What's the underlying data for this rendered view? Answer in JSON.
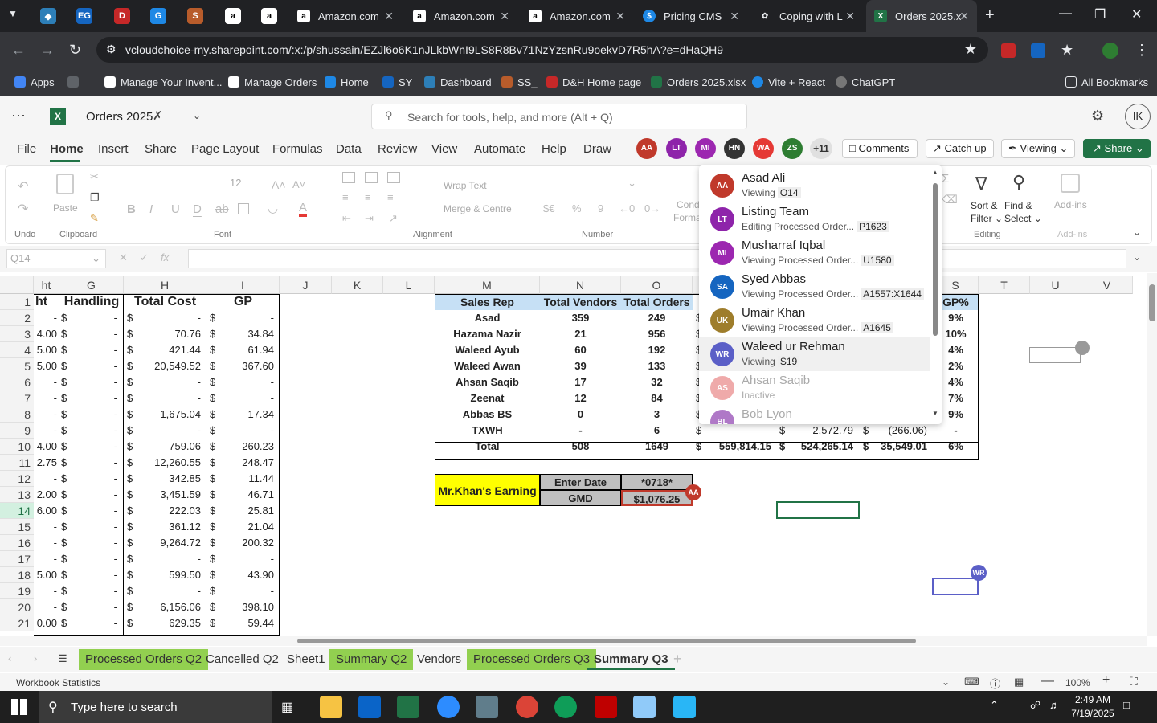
{
  "browser": {
    "tabs": [
      {
        "label": "Amazon.com"
      },
      {
        "label": "Amazon.com"
      },
      {
        "label": "Amazon.com"
      },
      {
        "label": "Pricing CMS"
      },
      {
        "label": "Coping with L"
      },
      {
        "label": "Orders 2025.x"
      }
    ],
    "address": "vcloudchoice-my.sharepoint.com/:x:/p/shussain/EZJl6o6K1nJLkbWnI9LS8R8Bv71NzYzsnRu9oekvD7R5hA?e=dHaQH9",
    "bookmarks": [
      "Apps",
      "Manage Your Invent...",
      "Manage Orders",
      "Home",
      "SY",
      "Dashboard",
      "SS_",
      "D&H Home page",
      "Orders 2025.xlsx",
      "Vite + React",
      "ChatGPT"
    ],
    "all_bookmarks": "All Bookmarks"
  },
  "excel": {
    "doc_title": "Orders 2025",
    "search_placeholder": "Search for tools, help, and more (Alt + Q)",
    "user_initials": "IK",
    "menu": [
      "File",
      "Home",
      "Insert",
      "Share",
      "Page Layout",
      "Formulas",
      "Data",
      "Review",
      "View",
      "Automate",
      "Help",
      "Draw"
    ],
    "collab_avatars": [
      {
        "i": "AA",
        "color": "#c0392b"
      },
      {
        "i": "LT",
        "color": "#8e24aa"
      },
      {
        "i": "MI",
        "color": "#9c27b0"
      },
      {
        "i": "HN",
        "color": "#333333"
      },
      {
        "i": "WA",
        "color": "#e53935"
      },
      {
        "i": "ZS",
        "color": "#2e7d32"
      }
    ],
    "more_count": "+11",
    "comments": "Comments",
    "catch_up": "Catch up",
    "viewing": "Viewing",
    "share": "Share",
    "ribbon": {
      "undo": "Undo",
      "clipboard": "Clipboard",
      "paste": "Paste",
      "font": "Font",
      "font_size": "12",
      "alignment": "Alignment",
      "wrap": "Wrap Text",
      "merge": "Merge & Centre",
      "number": "Number",
      "cond": "Cond",
      "forma": "Forma",
      "sort": "Sort &",
      "filter": "Filter",
      "find": "Find &",
      "select": "Select",
      "editing": "Editing",
      "addins": "Add-ins"
    },
    "namebox": "Q14"
  },
  "grid": {
    "columns": [
      "ht",
      "G",
      "H",
      "I",
      "J",
      "K",
      "L",
      "M",
      "N",
      "O",
      "",
      "",
      "",
      "S",
      "T",
      "U",
      "V"
    ],
    "rows": [
      "1",
      "2",
      "3",
      "4",
      "5",
      "6",
      "7",
      "8",
      "9",
      "10",
      "11",
      "12",
      "13",
      "14",
      "15",
      "16",
      "17",
      "18",
      "19",
      "20",
      "21"
    ],
    "left_headers": {
      "f": "ht",
      "g": "Handling",
      "h": "Total Cost",
      "i": "GP"
    },
    "left_rows": [
      [
        "-",
        "-",
        "-",
        "-"
      ],
      [
        "4.00",
        "-",
        "70.76",
        "34.84"
      ],
      [
        "5.00",
        "-",
        "421.44",
        "61.94"
      ],
      [
        "5.00",
        "-",
        "20,549.52",
        "367.60"
      ],
      [
        "-",
        "-",
        "-",
        "-"
      ],
      [
        "-",
        "-",
        "-",
        "-"
      ],
      [
        "-",
        "-",
        "1,675.04",
        "17.34"
      ],
      [
        "-",
        "-",
        "-",
        "-"
      ],
      [
        "4.00",
        "-",
        "759.06",
        "260.23"
      ],
      [
        "2.75",
        "-",
        "12,260.55",
        "248.47"
      ],
      [
        "-",
        "-",
        "342.85",
        "11.44"
      ],
      [
        "2.00",
        "-",
        "3,451.59",
        "46.71"
      ],
      [
        "6.00",
        "-",
        "222.03",
        "25.81"
      ],
      [
        "-",
        "-",
        "361.12",
        "21.04"
      ],
      [
        "-",
        "-",
        "9,264.72",
        "200.32"
      ],
      [
        "-",
        "-",
        "-",
        "-"
      ],
      [
        "5.00",
        "-",
        "599.50",
        "43.90"
      ],
      [
        "-",
        "-",
        "-",
        "-"
      ],
      [
        "-",
        "-",
        "6,156.06",
        "398.10"
      ],
      [
        "0.00",
        "-",
        "629.35",
        "59.44"
      ]
    ],
    "summary_headers": [
      "Sales Rep",
      "Total Vendors",
      "Total Orders",
      "GP%"
    ],
    "summary": [
      {
        "rep": "Asad",
        "v": "359",
        "o": "249",
        "gp": "9%"
      },
      {
        "rep": "Hazama Nazir",
        "v": "21",
        "o": "956",
        "gp": "10%"
      },
      {
        "rep": "Waleed Ayub",
        "v": "60",
        "o": "192",
        "gp": "4%"
      },
      {
        "rep": "Waleed Awan",
        "v": "39",
        "o": "133",
        "gp": "2%"
      },
      {
        "rep": "Ahsan Saqib",
        "v": "17",
        "o": "32",
        "gp": "4%"
      },
      {
        "rep": "Zeenat",
        "v": "12",
        "o": "84",
        "gp": "7%"
      },
      {
        "rep": "Abbas BS",
        "v": "0",
        "o": "3",
        "gp": "9%"
      },
      {
        "rep": "TXWH",
        "v": "-",
        "o": "6",
        "gp": "-"
      }
    ],
    "txwh_extra": [
      "$",
      "2,572.79",
      "$",
      "(266.06)"
    ],
    "total_row": {
      "label": "Total",
      "v": "508",
      "o": "1649",
      "a": "559,814.15",
      "b": "524,265.14",
      "c": "35,549.01",
      "gp": "6%"
    },
    "earning": {
      "title": "Mr.Khan's Earning",
      "enter_date": "Enter Date",
      "date_val": "*0718*",
      "gmd": "GMD",
      "gmd_val": "$1,076.25"
    }
  },
  "presence": [
    {
      "name": "Asad Ali",
      "i": "AA",
      "color": "#c0392b",
      "status": "Viewing",
      "where": "O14"
    },
    {
      "name": "Listing Team",
      "i": "LT",
      "color": "#8e24aa",
      "status": "Editing Processed Order...",
      "where": "P1623"
    },
    {
      "name": "Musharraf Iqbal",
      "i": "MI",
      "color": "#9c27b0",
      "status": "Viewing Processed Order...",
      "where": "U1580"
    },
    {
      "name": "Syed Abbas",
      "i": "SA",
      "color": "#1565c0",
      "status": "Viewing Processed Order...",
      "where": "A1557:X1644"
    },
    {
      "name": "Umair Khan",
      "i": "UK",
      "color": "#9e7d2b",
      "status": "Viewing Processed Order...",
      "where": "A1645"
    },
    {
      "name": "Waleed ur Rehman",
      "i": "WR",
      "color": "#5b5fc7",
      "status": "Viewing",
      "where": "S19"
    },
    {
      "name": "Ahsan Saqib",
      "i": "AS",
      "color": "#e57373",
      "status": "Inactive",
      "where": ""
    },
    {
      "name": "Bob Lyon",
      "i": "BL",
      "color": "#7b1fa2",
      "status": "",
      "where": ""
    }
  ],
  "sheets": [
    {
      "label": "Processed Orders Q2",
      "green": true
    },
    {
      "label": "Cancelled Q2",
      "green": false
    },
    {
      "label": "Sheet1",
      "green": false
    },
    {
      "label": "Summary Q2",
      "green": true
    },
    {
      "label": "Vendors",
      "green": false
    },
    {
      "label": "Processed Orders Q3",
      "green": true
    },
    {
      "label": "Summary Q3",
      "green": false,
      "active": true
    }
  ],
  "status": {
    "left": "Workbook Statistics",
    "zoom": "100%"
  },
  "taskbar": {
    "search": "Type here to search",
    "time": "2:49 AM",
    "date": "7/19/2025"
  }
}
